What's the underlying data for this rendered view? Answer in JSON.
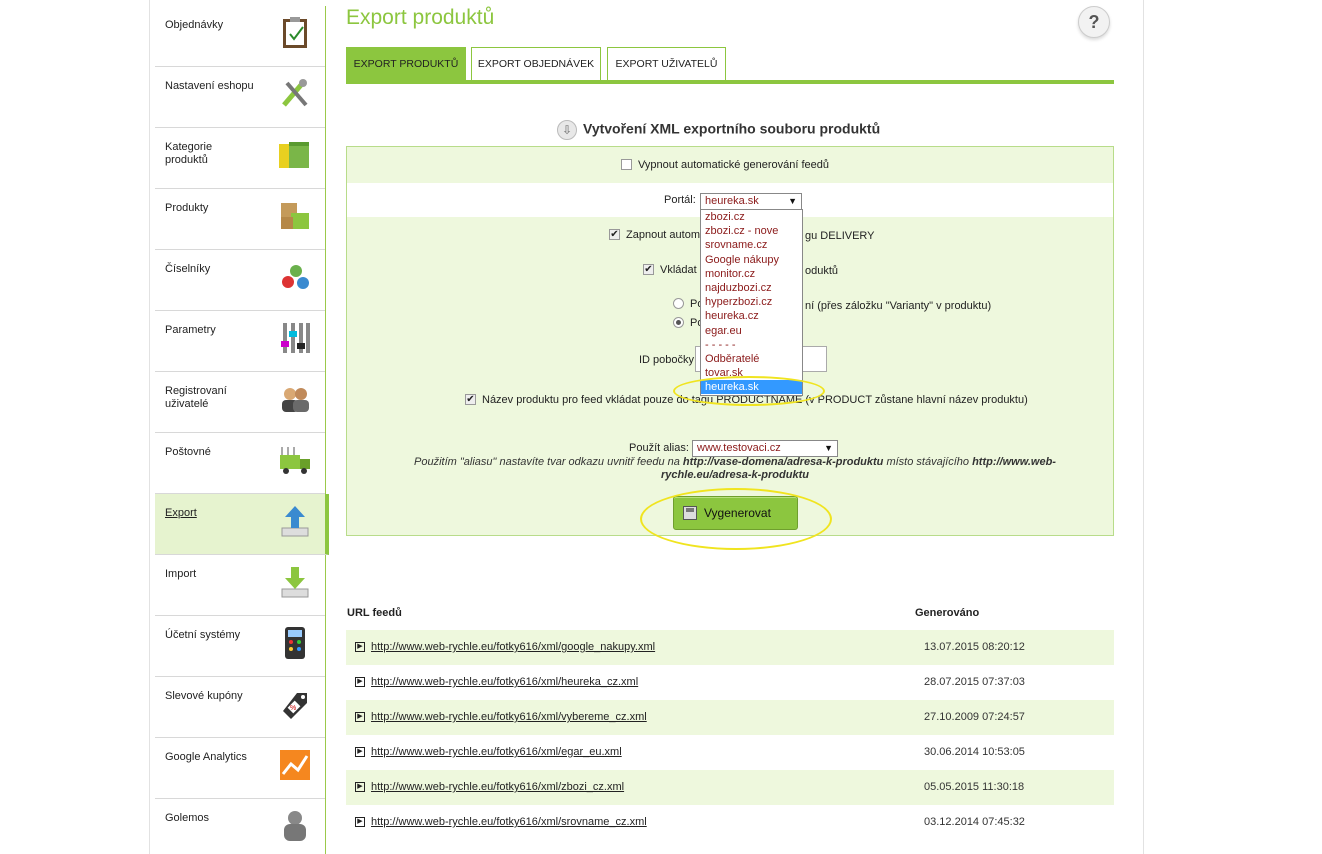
{
  "sidebar": {
    "items": [
      {
        "label": "Objednávky",
        "icon": "clipboard-icon"
      },
      {
        "label": "Nastavení eshopu",
        "icon": "tools-icon"
      },
      {
        "label": "Kategorie produktů",
        "icon": "folders-icon"
      },
      {
        "label": "Produkty",
        "icon": "boxes-icon"
      },
      {
        "label": "Číselníky",
        "icon": "numbered-balls-icon"
      },
      {
        "label": "Parametry",
        "icon": "sliders-icon"
      },
      {
        "label": "Registrovaní uživatelé",
        "icon": "users-icon"
      },
      {
        "label": "Poštovné",
        "icon": "truck-icon"
      },
      {
        "label": "Export",
        "icon": "upload-icon"
      },
      {
        "label": "Import",
        "icon": "download-icon"
      },
      {
        "label": "Účetní systémy",
        "icon": "calculator-icon"
      },
      {
        "label": "Slevové kupóny",
        "icon": "discount-tag-icon"
      },
      {
        "label": "Google Analytics",
        "icon": "analytics-icon"
      },
      {
        "label": "Golemos",
        "icon": "golem-icon"
      }
    ],
    "active_index": 8
  },
  "header": {
    "title": "Export produktů",
    "help": "?"
  },
  "tabs": [
    "EXPORT PRODUKTŮ",
    "EXPORT OBJEDNÁVEK",
    "EXPORT UŽIVATELŮ"
  ],
  "form": {
    "title": "Vytvoření XML exportního souboru produktů",
    "disable_auto_label": "Vypnout automatické generování feedů",
    "portal_label": "Portál:",
    "portal_value": "heureka.sk",
    "delivery_label_left": "Zapnout autom",
    "delivery_label_right": "gu DELIVERY",
    "insert_label_left": "Vkládat",
    "insert_label_right": "oduktů",
    "radio1_left": "Po",
    "radio1_right": "ní (přes záložku \"Varianty\" v produktu)",
    "radio2_left": "Po",
    "id_label": "ID pobočky",
    "productname_left": "Název produktu pro feed vkládat pouze do tagu PRODUCTNAME (v PRODUCT zůstane hlavní název produktu)",
    "alias_label": "Použít alias:",
    "alias_value": "www.testovaci.cz",
    "note_prefix": "Použitím \"aliasu\" nastavíte tvar odkazu uvnitř feedu na ",
    "note_link1": "http://vase-domena/adresa-k-produktu",
    "note_mid": " místo stávajícího ",
    "note_link2": "http://www.web-rychle.eu/adresa-k-produktu",
    "button": "Vygenerovat"
  },
  "dropdown_options": [
    "zbozi.cz",
    "zbozi.cz - nove",
    "srovname.cz",
    "Google nákupy",
    "monitor.cz",
    "najduzbozi.cz",
    "hyperzbozi.cz",
    "heureka.cz",
    "egar.eu",
    "- - - - -",
    "Odběratelé",
    "tovar.sk",
    "heureka.sk"
  ],
  "table": {
    "headers": [
      "URL feedů",
      "Generováno"
    ],
    "rows": [
      {
        "url": "http://www.web-rychle.eu/fotky616/xml/google_nakupy.xml",
        "date": "13.07.2015 08:20:12"
      },
      {
        "url": "http://www.web-rychle.eu/fotky616/xml/heureka_cz.xml",
        "date": "28.07.2015 07:37:03"
      },
      {
        "url": "http://www.web-rychle.eu/fotky616/xml/vybereme_cz.xml",
        "date": "27.10.2009 07:24:57"
      },
      {
        "url": "http://www.web-rychle.eu/fotky616/xml/egar_eu.xml",
        "date": "30.06.2014 10:53:05"
      },
      {
        "url": "http://www.web-rychle.eu/fotky616/xml/zbozi_cz.xml",
        "date": "05.05.2015 11:30:18"
      },
      {
        "url": "http://www.web-rychle.eu/fotky616/xml/srovname_cz.xml",
        "date": "03.12.2014 07:45:32"
      }
    ]
  },
  "colors": {
    "accent": "#8cc63f",
    "panel_bg": "#eef8dd",
    "highlight_ellipse": "#f0e41f",
    "select_text": "#8b1a1a"
  }
}
